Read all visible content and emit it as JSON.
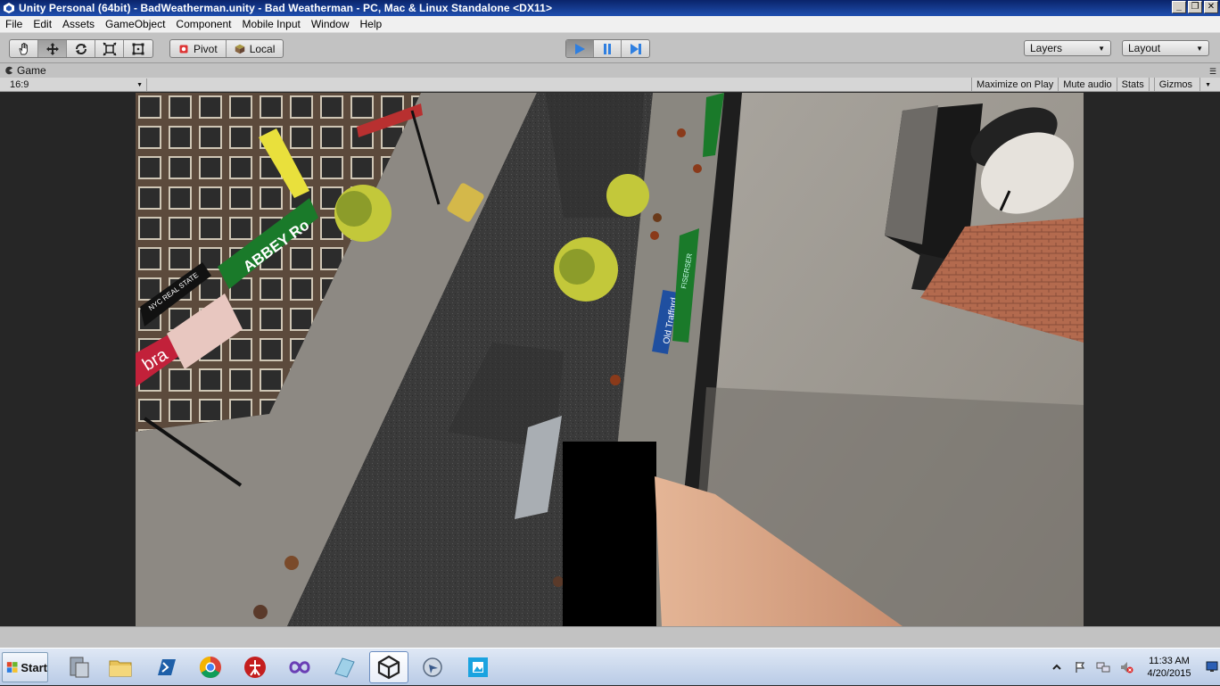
{
  "window": {
    "title": "Unity Personal (64bit) - BadWeatherman.unity - Bad Weatherman - PC, Mac & Linux Standalone <DX11>"
  },
  "menu": [
    "File",
    "Edit",
    "Assets",
    "GameObject",
    "Component",
    "Mobile Input",
    "Window",
    "Help"
  ],
  "toolbar": {
    "pivot_label": "Pivot",
    "local_label": "Local",
    "layers_label": "Layers",
    "layout_label": "Layout"
  },
  "game_panel": {
    "tab_label": "Game",
    "aspect": "16:9",
    "maximize_label": "Maximize on Play",
    "mute_label": "Mute audio",
    "stats_label": "Stats",
    "gizmos_label": "Gizmos"
  },
  "scene": {
    "sign_abbey": "ABBEY Ro",
    "sign_realestate": "NYC REAL STATE",
    "sign_bra": "bra",
    "sign_trafford": "Old Trafford",
    "sign_green": "FISERSER"
  },
  "taskbar": {
    "start_label": "Start",
    "time": "11:33 AM",
    "date": "4/20/2015"
  }
}
